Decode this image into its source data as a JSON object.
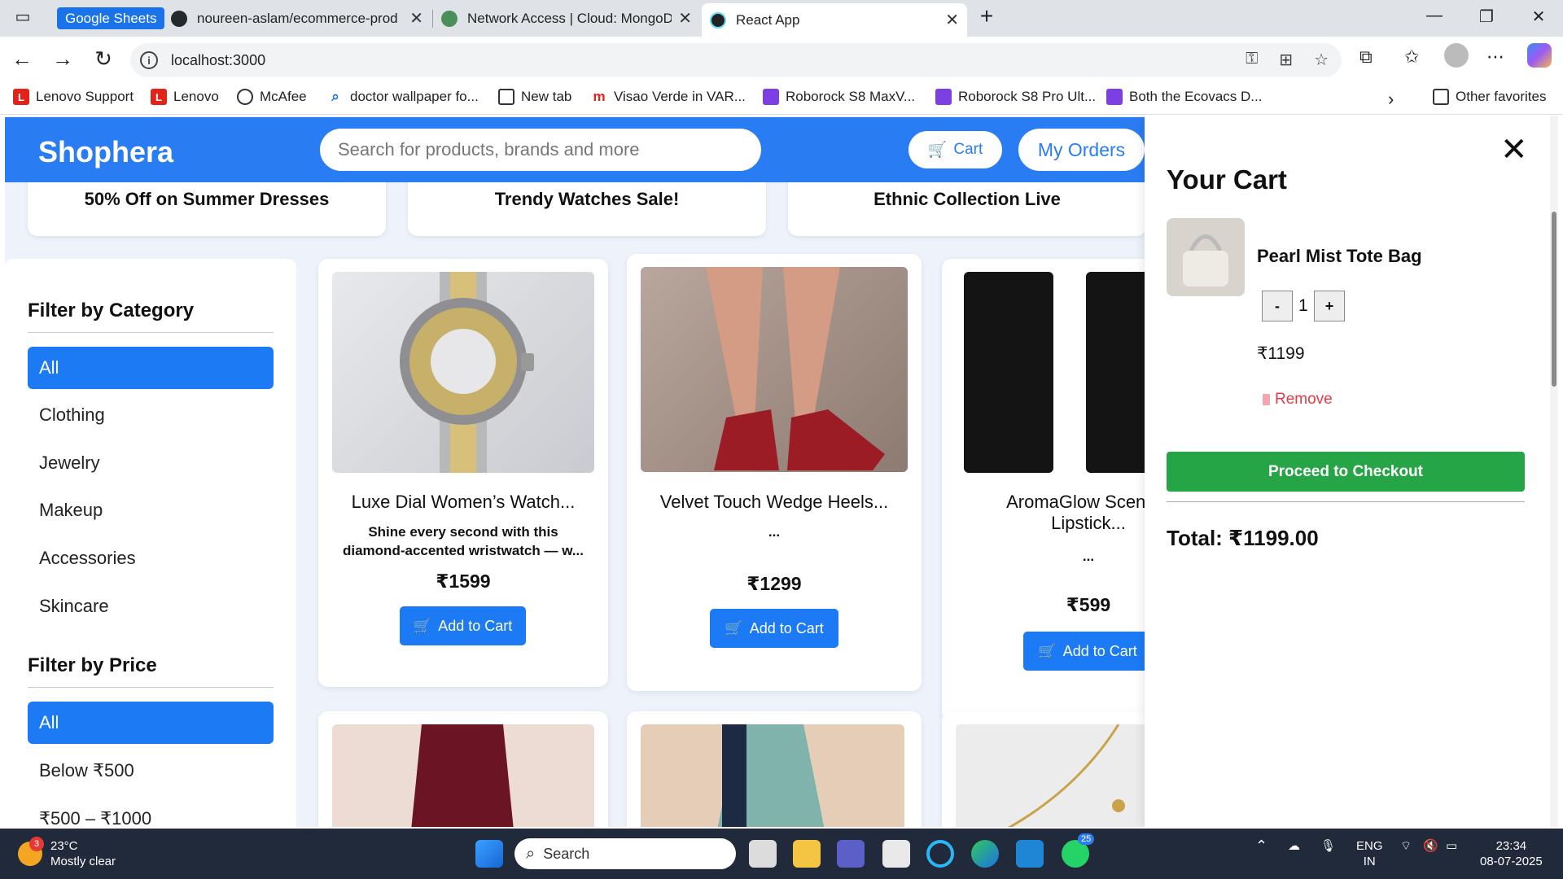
{
  "browser": {
    "tabs": [
      {
        "title": "Google Sheets",
        "active": false
      },
      {
        "title": "noureen-aslam/ecommerce-prod",
        "active": false
      },
      {
        "title": "Network Access | Cloud: MongoD",
        "active": false
      },
      {
        "title": "React App",
        "active": true
      }
    ],
    "new_tab_icon": "plus-icon",
    "url": "localhost:3000",
    "bookmarks": [
      "Lenovo Support",
      "Lenovo",
      "McAfee",
      "doctor wallpaper fo...",
      "New tab",
      "Visao Verde in VAR...",
      "Roborock S8 MaxV...",
      "Roborock S8 Pro Ult...",
      "Both the Ecovacs D..."
    ],
    "other_favorites": "Other favorites"
  },
  "app": {
    "brand": "Shophera",
    "search_placeholder": "Search for products, brands and more",
    "cart_label": "Cart",
    "orders_label": "My Orders",
    "accent": "#2a7cf3",
    "promos": [
      "50% Off on Summer Dresses",
      "Trendy Watches Sale!",
      "Ethnic Collection Live"
    ]
  },
  "filters": {
    "category_heading": "Filter by Category",
    "categories": [
      "All",
      "Clothing",
      "Jewelry",
      "Makeup",
      "Accessories",
      "Skincare"
    ],
    "selected_category": "All",
    "price_heading": "Filter by Price",
    "prices": [
      "All",
      "Below ₹500",
      "₹500 – ₹1000"
    ],
    "selected_price": "All"
  },
  "products": [
    {
      "title": "Luxe Dial Women’s Watch...",
      "desc_line1": "Shine every second with this",
      "desc_line2": "diamond-accented wristwatch — w...",
      "price": "₹1599",
      "button": "Add to Cart"
    },
    {
      "title": "Velvet Touch Wedge Heels...",
      "desc_line1": "...",
      "desc_line2": "",
      "price": "₹1299",
      "button": "Add to Cart"
    },
    {
      "title_line1": "AromaGlow Scented",
      "title_line2": "Lipstick...",
      "desc_line1": "...",
      "price": "₹599",
      "button": "Add to Cart"
    }
  ],
  "cart": {
    "title": "Your Cart",
    "items": [
      {
        "name": "Pearl Mist Tote Bag",
        "qty": "1",
        "price": "₹1199",
        "remove": "Remove",
        "dec": "-",
        "inc": "+"
      }
    ],
    "checkout": "Proceed to Checkout",
    "total": "Total: ₹1199.00",
    "checkout_color": "#25a545"
  },
  "taskbar": {
    "temp": "23°C",
    "weather": "Mostly clear",
    "weather_badge": "3",
    "search": "Search",
    "lang1": "ENG",
    "lang2": "IN",
    "time": "23:34",
    "date": "08-07-2025",
    "whatsapp_badge": "25"
  }
}
